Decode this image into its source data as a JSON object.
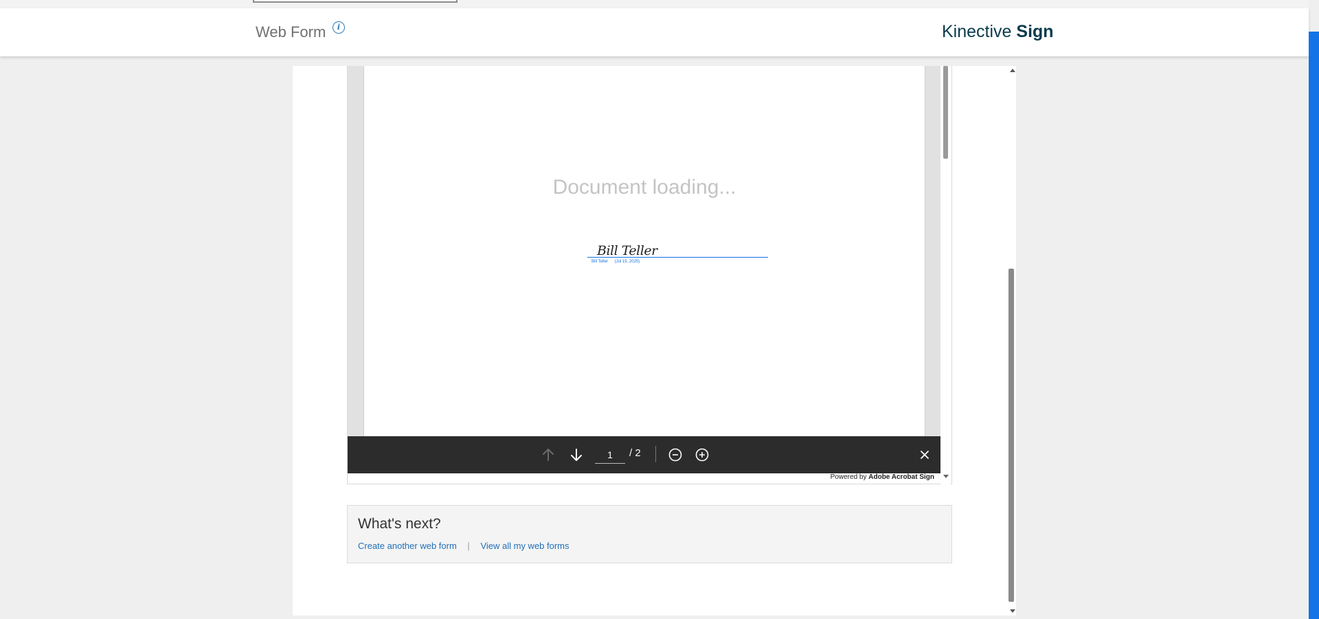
{
  "header": {
    "title": "Web Form",
    "info_icon": "info-icon",
    "brand_light": "Kinective",
    "brand_bold": "Sign"
  },
  "document": {
    "loading_text": "Document loading...",
    "signature_name": "Bill Teller",
    "signature_caption_name": "Bill Teller",
    "signature_caption_date": "(Jul 15, 2025)"
  },
  "toolbar": {
    "prev_icon": "arrow-up-icon",
    "next_icon": "arrow-down-icon",
    "current_page": "1",
    "page_total": "/ 2",
    "zoom_out_icon": "zoom-out-icon",
    "zoom_in_icon": "zoom-in-icon",
    "close_icon": "close-icon"
  },
  "powered_by": {
    "prefix": "Powered by",
    "brand": "Adobe Acrobat Sign"
  },
  "whats_next": {
    "title": "What's next?",
    "link_create": "Create another web form",
    "separator": "|",
    "link_view": "View all my web forms"
  },
  "colors": {
    "accent_blue": "#1473e6",
    "brand_dark": "#0b3b4d",
    "link_blue": "#2270b8",
    "toolbar_bg": "#2c2c2c"
  }
}
